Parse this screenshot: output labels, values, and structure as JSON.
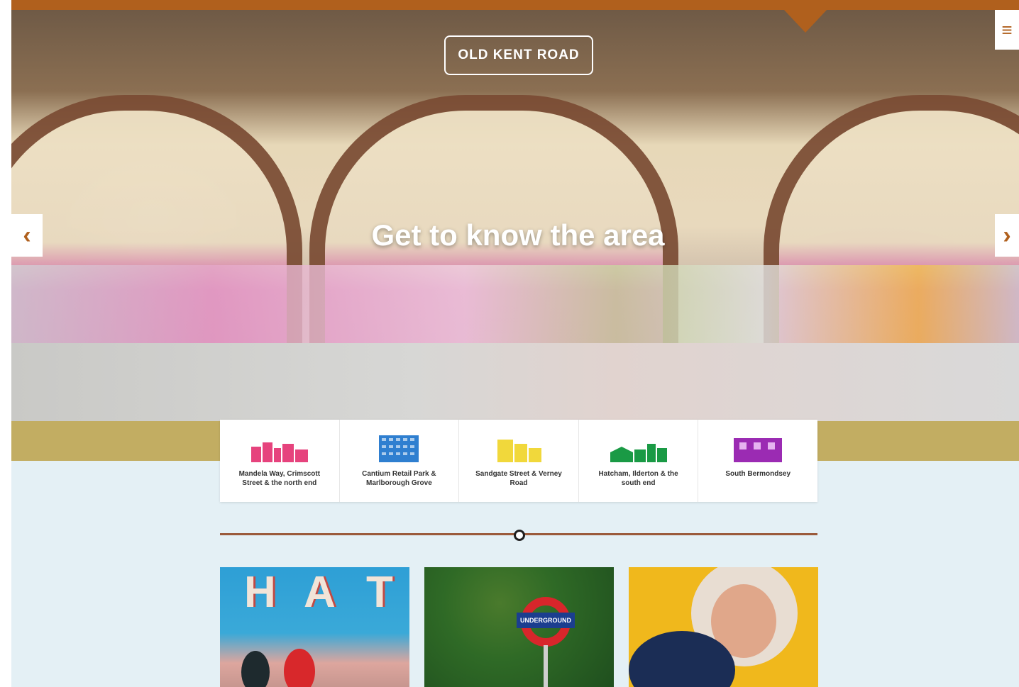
{
  "brand": {
    "logo_text": "OLD KENT ROAD"
  },
  "header": {
    "menu_icon": "hamburger-menu-icon",
    "accent_color": "#b0601d"
  },
  "hero": {
    "title": "Get to know the area",
    "prev_label": "‹",
    "next_label": "›"
  },
  "areas": [
    {
      "label": "Mandela Way, Crimscott Street & the north end",
      "icon": "area-skyline-icon",
      "color": "#e6437d"
    },
    {
      "label": "Cantium Retail Park & Marlborough Grove",
      "icon": "area-skyline-icon",
      "color": "#2f7fd0"
    },
    {
      "label": "Sandgate Street & Verney Road",
      "icon": "area-skyline-icon",
      "color": "#f1d83b"
    },
    {
      "label": "Hatcham, Ilderton & the south end",
      "icon": "area-skyline-icon",
      "color": "#1a9a45"
    },
    {
      "label": "South Bermondsey",
      "icon": "area-skyline-icon",
      "color": "#9b2bb3"
    }
  ],
  "stories": [
    {
      "sign_letters": [
        "H",
        "A",
        "T"
      ]
    },
    {
      "sign_text": "UNDERGROUND"
    },
    {}
  ],
  "colors": {
    "page_background": "#e4f0f5",
    "divider": "#9a5a3a"
  }
}
